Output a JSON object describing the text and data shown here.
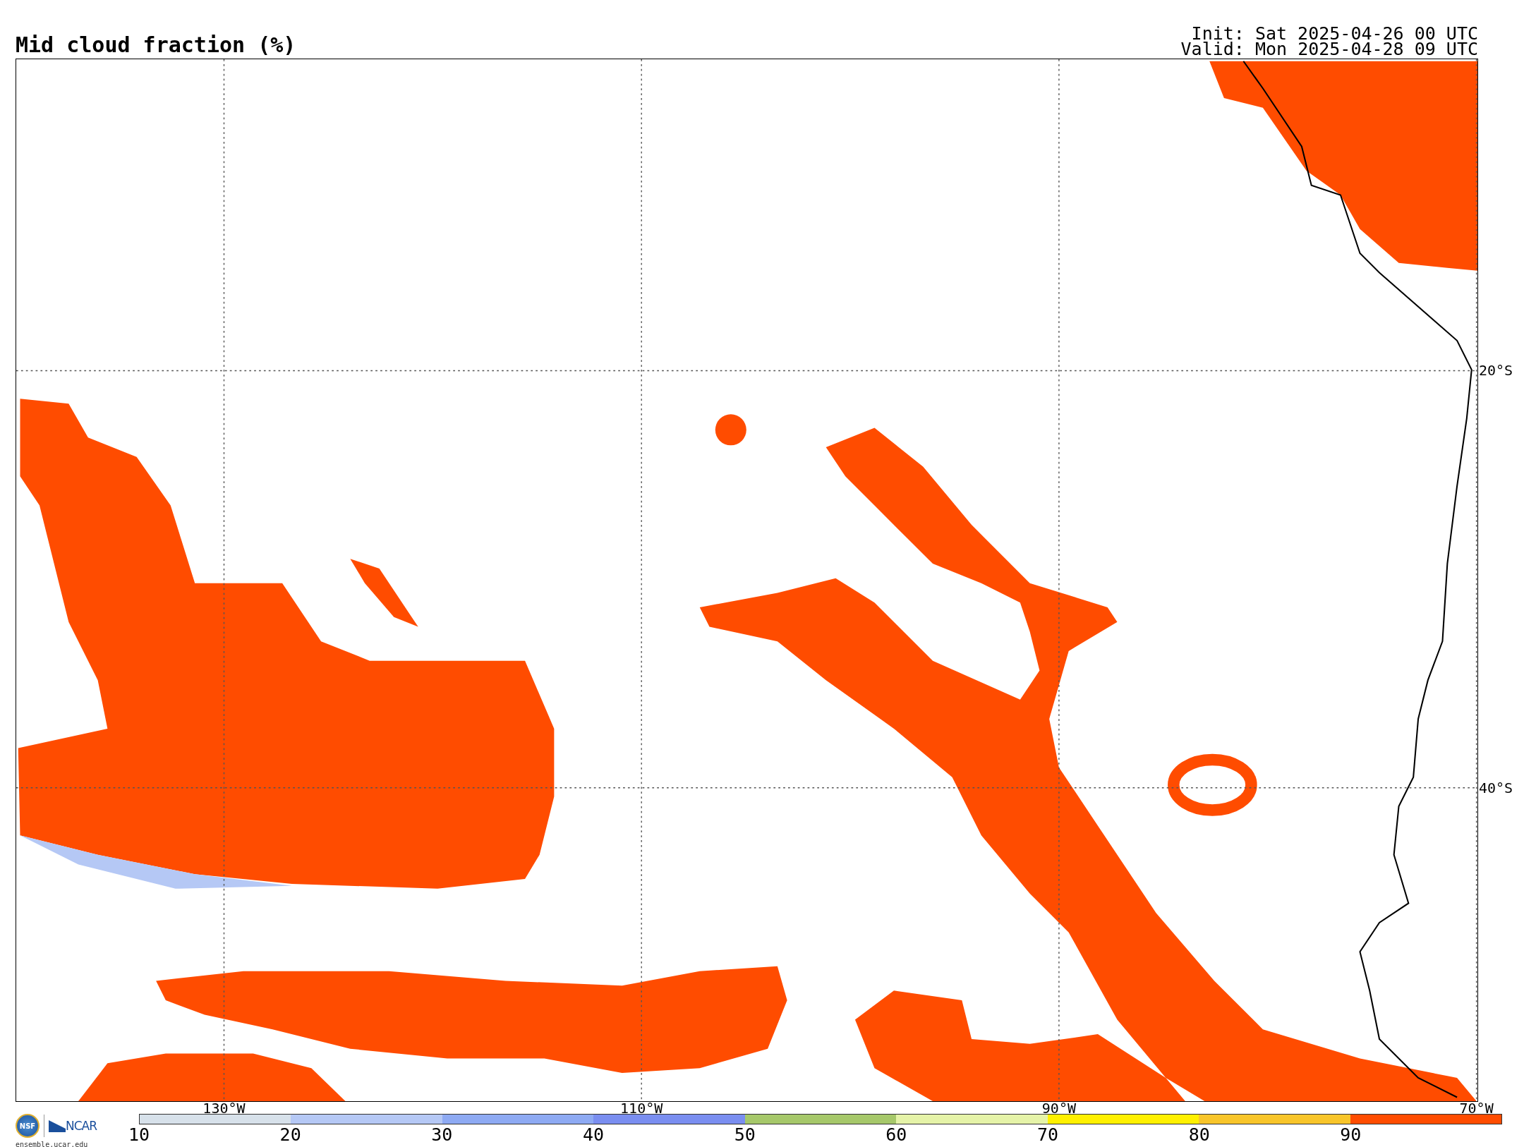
{
  "title": "Mid cloud fraction (%)",
  "init": "Init: Sat 2025-04-26 00 UTC",
  "valid": "Valid: Mon 2025-04-28 09 UTC",
  "map": {
    "lon_labels": [
      "130°W",
      "110°W",
      "90°W",
      "70°W"
    ],
    "lat_labels": [
      "20°S",
      "40°S"
    ]
  },
  "colorbar": {
    "ticks": [
      "10",
      "20",
      "30",
      "40",
      "50",
      "60",
      "70",
      "80",
      "90"
    ],
    "bins": [
      {
        "color": "#d7e1ea"
      },
      {
        "color": "#b5c8f5"
      },
      {
        "color": "#8eaaf3"
      },
      {
        "color": "#7a8ef0"
      },
      {
        "color": "#a6c86a"
      },
      {
        "color": "#e5f3a8"
      },
      {
        "color": "#fff000"
      },
      {
        "color": "#f8c52a"
      },
      {
        "color": "#ff4c00"
      }
    ]
  },
  "logos": {
    "nsf": "NSF",
    "ncar": "NCAR",
    "site": "ensemble.ucar.edu"
  }
}
